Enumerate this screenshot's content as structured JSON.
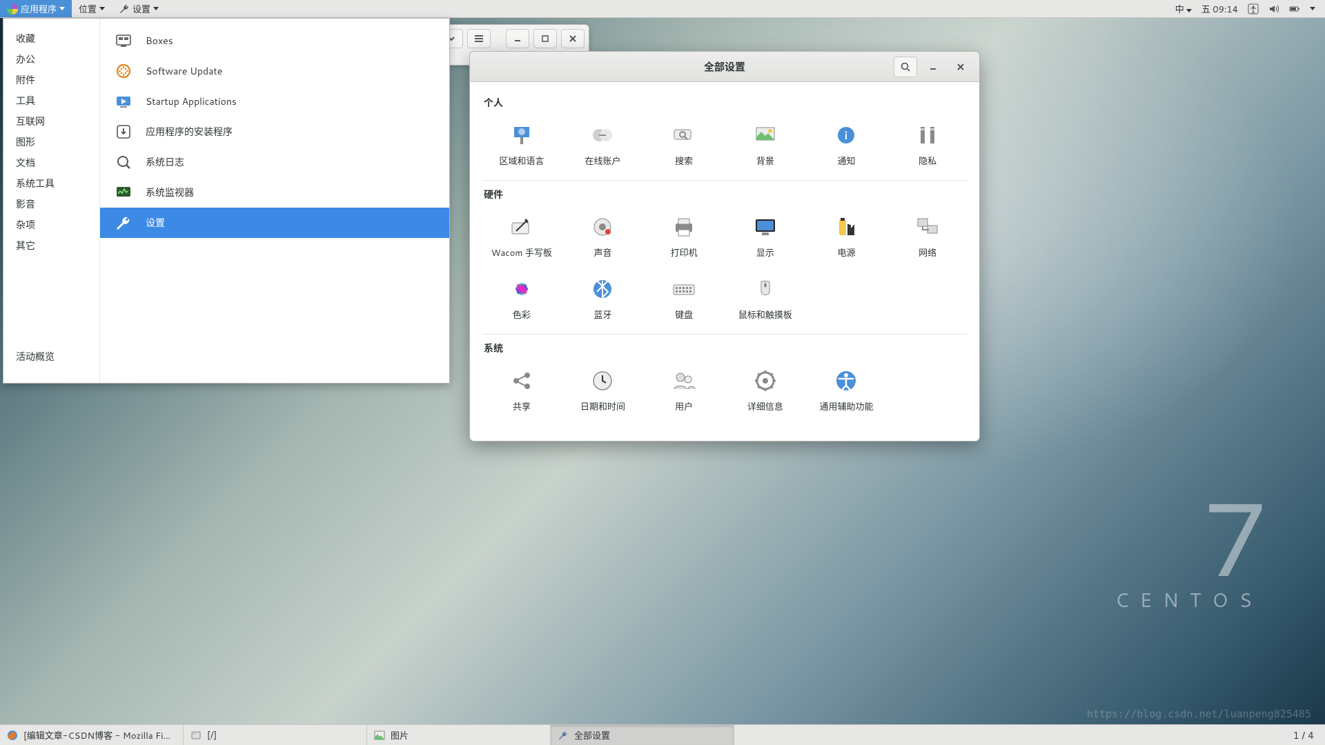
{
  "panel": {
    "apps_label": "应用程序",
    "places_label": "位置",
    "settings_label": "设置",
    "ime": "中",
    "clock": "五 09:14"
  },
  "apps_menu": {
    "categories": [
      "收藏",
      "办公",
      "附件",
      "工具",
      "互联网",
      "图形",
      "文档",
      "系统工具",
      "影音",
      "杂项",
      "其它"
    ],
    "activities": "活动概览",
    "items": [
      {
        "label": "Boxes",
        "icon": "boxes"
      },
      {
        "label": "Software Update",
        "icon": "update"
      },
      {
        "label": "Startup Applications",
        "icon": "startup"
      },
      {
        "label": "应用程序的安装程序",
        "icon": "installer"
      },
      {
        "label": "系统日志",
        "icon": "logs"
      },
      {
        "label": "系统监视器",
        "icon": "monitor"
      },
      {
        "label": "设置",
        "icon": "settings"
      }
    ],
    "selected_index": 6
  },
  "settings_window": {
    "title": "全部设置",
    "sections": [
      {
        "title": "个人",
        "tiles": [
          {
            "label": "区域和语言",
            "icon": "region"
          },
          {
            "label": "在线账户",
            "icon": "online-accounts"
          },
          {
            "label": "搜索",
            "icon": "search"
          },
          {
            "label": "背景",
            "icon": "background"
          },
          {
            "label": "通知",
            "icon": "notifications"
          },
          {
            "label": "隐私",
            "icon": "privacy"
          }
        ]
      },
      {
        "title": "硬件",
        "tiles": [
          {
            "label": "Wacom 手写板",
            "icon": "wacom"
          },
          {
            "label": "声音",
            "icon": "sound"
          },
          {
            "label": "打印机",
            "icon": "printer"
          },
          {
            "label": "显示",
            "icon": "display"
          },
          {
            "label": "电源",
            "icon": "power"
          },
          {
            "label": "网络",
            "icon": "network"
          },
          {
            "label": "色彩",
            "icon": "color"
          },
          {
            "label": "蓝牙",
            "icon": "bluetooth"
          },
          {
            "label": "键盘",
            "icon": "keyboard"
          },
          {
            "label": "鼠标和触摸板",
            "icon": "mouse"
          }
        ]
      },
      {
        "title": "系统",
        "tiles": [
          {
            "label": "共享",
            "icon": "sharing"
          },
          {
            "label": "日期和时间",
            "icon": "datetime"
          },
          {
            "label": "用户",
            "icon": "users"
          },
          {
            "label": "详细信息",
            "icon": "details"
          },
          {
            "label": "通用辅助功能",
            "icon": "accessibility"
          }
        ]
      }
    ]
  },
  "taskbar": {
    "items": [
      {
        "label": "[编辑文章-CSDN博客 - Mozilla Fi…",
        "icon": "firefox",
        "active": false
      },
      {
        "label": "[/]",
        "icon": "files",
        "active": false
      },
      {
        "label": "图片",
        "icon": "image",
        "active": false
      },
      {
        "label": "全部设置",
        "icon": "settings",
        "active": true
      }
    ],
    "pager": "1 / 4"
  },
  "branding": {
    "version": "7",
    "name": "CENTOS"
  },
  "watermark": "https://blog.csdn.net/luanpeng825485"
}
